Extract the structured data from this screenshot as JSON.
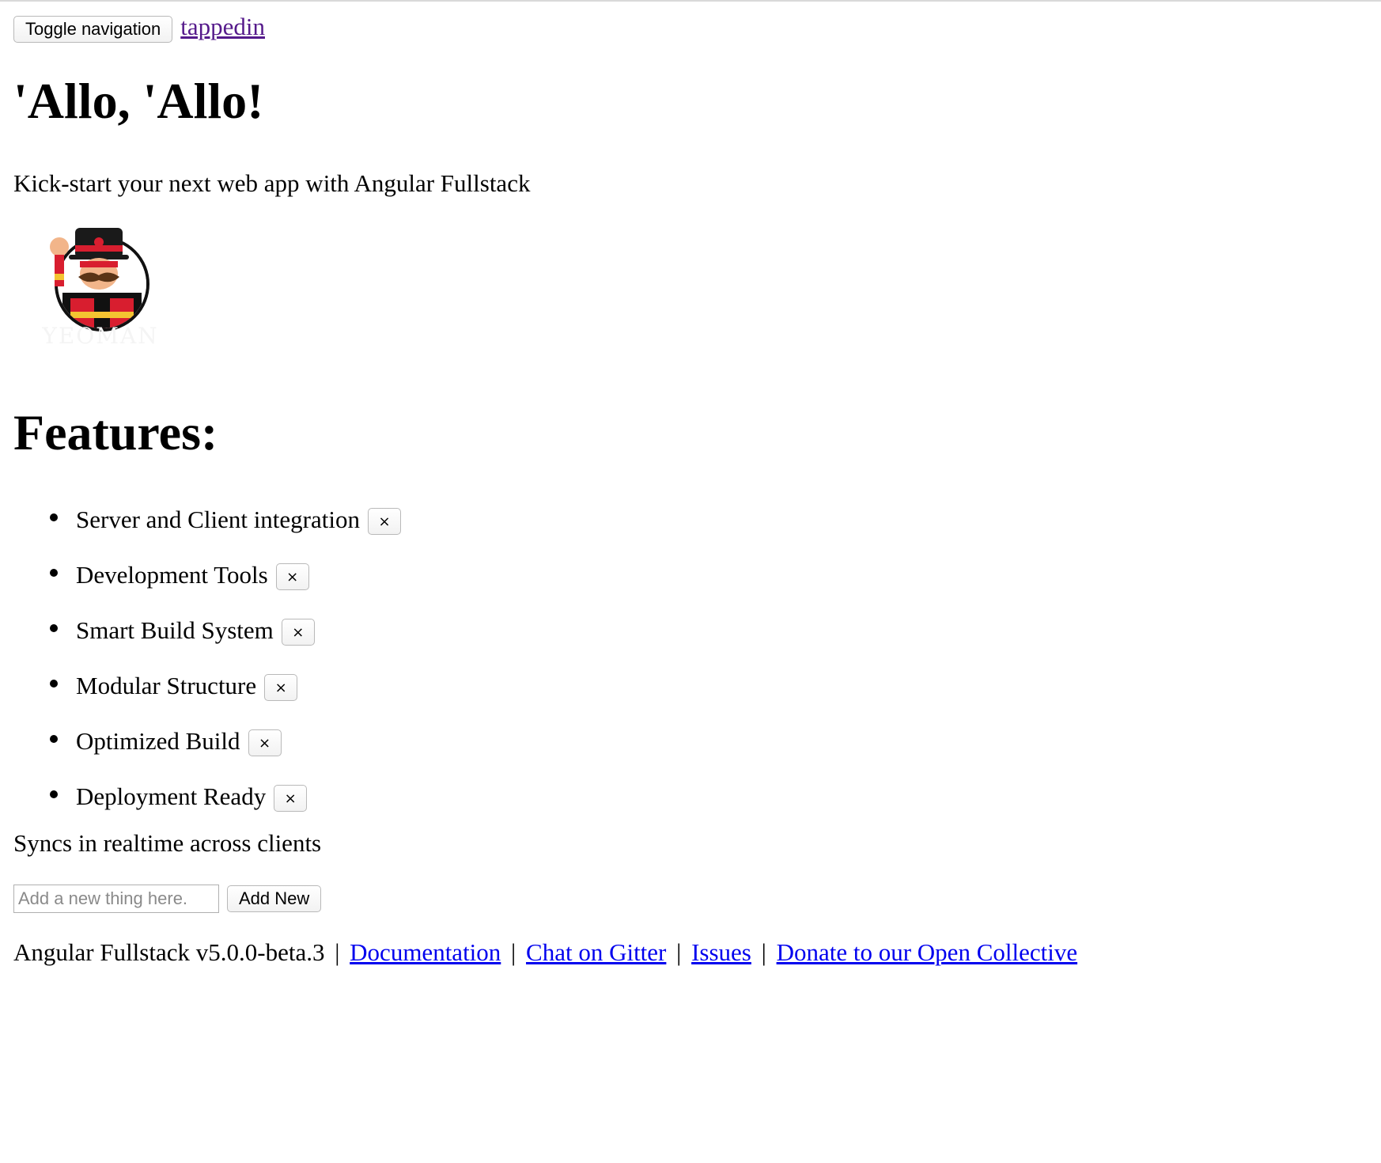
{
  "navbar": {
    "toggle_label": "Toggle navigation",
    "brand": "tappedin"
  },
  "hero": {
    "title": "'Allo, 'Allo!",
    "lead": "Kick-start your next web app with Angular Fullstack",
    "logo_text": "YEOMAN"
  },
  "features": {
    "title": "Features:",
    "close_label": "×",
    "items": [
      "Server and Client integration",
      "Development Tools",
      "Smart Build System",
      "Modular Structure",
      "Optimized Build",
      "Deployment Ready"
    ]
  },
  "sync_text": "Syncs in realtime across clients",
  "add_form": {
    "placeholder": "Add a new thing here.",
    "button_label": "Add New"
  },
  "footer": {
    "version_text": "Angular Fullstack v5.0.0-beta.3",
    "separator": "|",
    "links": [
      "Documentation",
      "Chat on Gitter",
      "Issues",
      "Donate to our Open Collective"
    ]
  },
  "colors": {
    "link": "#0000ee",
    "visited_link": "#551a8b",
    "border": "#b9b9b9"
  }
}
